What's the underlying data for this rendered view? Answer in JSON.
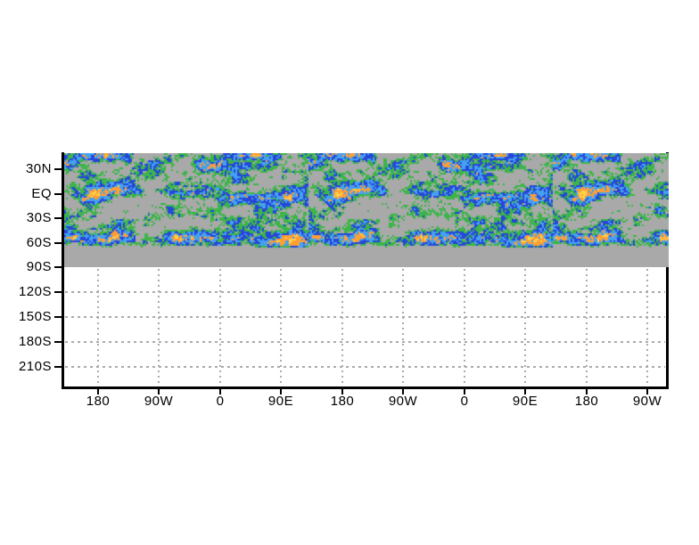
{
  "page": {
    "background": "#ffffff"
  },
  "chart_data": {
    "type": "heatmap",
    "title": "",
    "x_axis": {
      "tick_labels": [
        "180",
        "90W",
        "0",
        "90E",
        "180",
        "90W",
        "0",
        "90E",
        "180",
        "90W"
      ],
      "description": "longitude axis, field tiled about 2.5 times"
    },
    "y_axis": {
      "tick_labels": [
        "30N",
        "EQ",
        "30S",
        "60S",
        "90S",
        "120S",
        "150S",
        "180S",
        "210S"
      ],
      "description": "latitude axis; no data plotted below 90S band edge"
    },
    "field": {
      "background_color": "#a9a9a9",
      "band_top_near_label": "30N",
      "band_bottom_label": "90S",
      "levels": [
        {
          "rank": 1,
          "name": "green",
          "color": "#3cb54a"
        },
        {
          "rank": 2,
          "name": "blue",
          "color": "#2747d9"
        },
        {
          "rank": 3,
          "name": "light-blue",
          "color": "#45a1f0"
        },
        {
          "rank": 4,
          "name": "orange",
          "color": "#ff9e33"
        },
        {
          "rank": 5,
          "name": "yellow",
          "color": "#ffd24a"
        }
      ],
      "pattern": "speckled shaded-contour anomaly field; dense zonal belts near EQ and 60S with orange cores; solid gray strip down to 90S; blank white below 90S"
    },
    "gridlines": {
      "style": "dotted",
      "color": "#ababab",
      "horizontal_at": [
        "120S",
        "150S",
        "180S",
        "210S"
      ],
      "vertical_at": "every longitude tick below the shaded band"
    },
    "axis_color": "#000000"
  }
}
